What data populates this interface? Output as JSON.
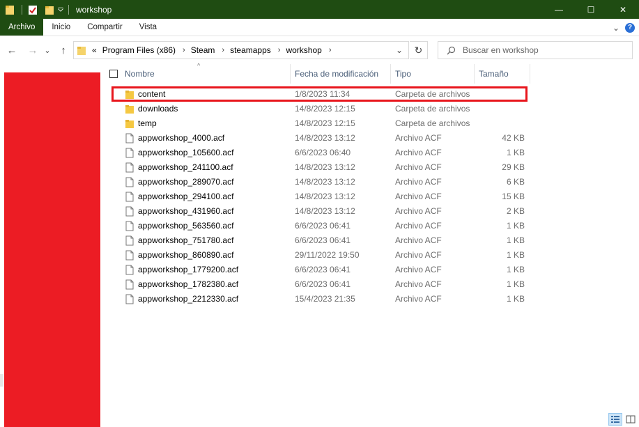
{
  "window": {
    "title": "workshop",
    "controls": {
      "minimize": "—",
      "maximize": "☐",
      "close": "✕"
    }
  },
  "ribbon": {
    "tabs": [
      {
        "label": "Archivo",
        "active": true
      },
      {
        "label": "Inicio",
        "active": false
      },
      {
        "label": "Compartir",
        "active": false
      },
      {
        "label": "Vista",
        "active": false
      }
    ],
    "expand_glyph": "⌄",
    "help_glyph": "?"
  },
  "nav": {
    "back_glyph": "←",
    "forward_glyph": "→",
    "recent_glyph": "⌄",
    "up_glyph": "↑",
    "overflow": "«",
    "breadcrumb": [
      "Program Files (x86)",
      "Steam",
      "steamapps",
      "workshop"
    ],
    "crumb_sep": "›",
    "dropdown_glyph": "⌄",
    "refresh_glyph": "↻"
  },
  "search": {
    "placeholder": "Buscar en workshop"
  },
  "columns": {
    "name": "Nombre",
    "date": "Fecha de modificación",
    "type": "Tipo",
    "size": "Tamaño",
    "sort_glyph": "^"
  },
  "files": [
    {
      "name": "content",
      "date": "1/8/2023 11:34",
      "type": "Carpeta de archivos",
      "size": "",
      "kind": "folder",
      "highlighted": true
    },
    {
      "name": "downloads",
      "date": "14/8/2023 12:15",
      "type": "Carpeta de archivos",
      "size": "",
      "kind": "folder"
    },
    {
      "name": "temp",
      "date": "14/8/2023 12:15",
      "type": "Carpeta de archivos",
      "size": "",
      "kind": "folder"
    },
    {
      "name": "appworkshop_4000.acf",
      "date": "14/8/2023 13:12",
      "type": "Archivo ACF",
      "size": "42 KB",
      "kind": "file"
    },
    {
      "name": "appworkshop_105600.acf",
      "date": "6/6/2023 06:40",
      "type": "Archivo ACF",
      "size": "1 KB",
      "kind": "file"
    },
    {
      "name": "appworkshop_241100.acf",
      "date": "14/8/2023 13:12",
      "type": "Archivo ACF",
      "size": "29 KB",
      "kind": "file"
    },
    {
      "name": "appworkshop_289070.acf",
      "date": "14/8/2023 13:12",
      "type": "Archivo ACF",
      "size": "6 KB",
      "kind": "file"
    },
    {
      "name": "appworkshop_294100.acf",
      "date": "14/8/2023 13:12",
      "type": "Archivo ACF",
      "size": "15 KB",
      "kind": "file"
    },
    {
      "name": "appworkshop_431960.acf",
      "date": "14/8/2023 13:12",
      "type": "Archivo ACF",
      "size": "2 KB",
      "kind": "file"
    },
    {
      "name": "appworkshop_563560.acf",
      "date": "6/6/2023 06:41",
      "type": "Archivo ACF",
      "size": "1 KB",
      "kind": "file"
    },
    {
      "name": "appworkshop_751780.acf",
      "date": "6/6/2023 06:41",
      "type": "Archivo ACF",
      "size": "1 KB",
      "kind": "file"
    },
    {
      "name": "appworkshop_860890.acf",
      "date": "29/11/2022 19:50",
      "type": "Archivo ACF",
      "size": "1 KB",
      "kind": "file"
    },
    {
      "name": "appworkshop_1779200.acf",
      "date": "6/6/2023 06:41",
      "type": "Archivo ACF",
      "size": "1 KB",
      "kind": "file"
    },
    {
      "name": "appworkshop_1782380.acf",
      "date": "6/6/2023 06:41",
      "type": "Archivo ACF",
      "size": "1 KB",
      "kind": "file"
    },
    {
      "name": "appworkshop_2212330.acf",
      "date": "15/4/2023 21:35",
      "type": "Archivo ACF",
      "size": "1 KB",
      "kind": "file"
    }
  ],
  "colors": {
    "titlebar": "#1f4c12",
    "highlight_border": "#e8151c",
    "redaction": "#ec1c24",
    "folder": "#f5c842"
  },
  "icons": {
    "folder": "folder-icon",
    "file": "file-icon",
    "search": "search-icon",
    "refresh": "refresh-icon"
  }
}
